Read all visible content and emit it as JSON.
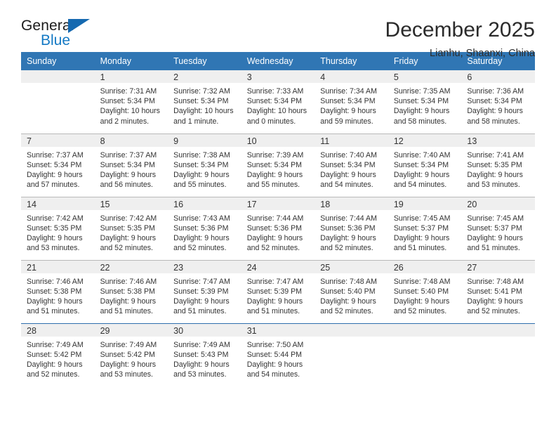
{
  "brand": {
    "name_part1": "General",
    "name_part2": "Blue",
    "accent_color": "#1479c4",
    "triangle_color": "#1569b0"
  },
  "header": {
    "title": "December 2025",
    "location": "Lianhu, Shaanxi, China",
    "header_bg": "#3076b4",
    "daynum_bg": "#efefef"
  },
  "weekdays": [
    "Sunday",
    "Monday",
    "Tuesday",
    "Wednesday",
    "Thursday",
    "Friday",
    "Saturday"
  ],
  "weeks": [
    [
      {
        "day": "",
        "sunrise": "",
        "sunset": "",
        "daylight_line1": "",
        "daylight_line2": "",
        "blank": true
      },
      {
        "day": "1",
        "sunrise": "Sunrise: 7:31 AM",
        "sunset": "Sunset: 5:34 PM",
        "daylight_line1": "Daylight: 10 hours",
        "daylight_line2": "and 2 minutes."
      },
      {
        "day": "2",
        "sunrise": "Sunrise: 7:32 AM",
        "sunset": "Sunset: 5:34 PM",
        "daylight_line1": "Daylight: 10 hours",
        "daylight_line2": "and 1 minute."
      },
      {
        "day": "3",
        "sunrise": "Sunrise: 7:33 AM",
        "sunset": "Sunset: 5:34 PM",
        "daylight_line1": "Daylight: 10 hours",
        "daylight_line2": "and 0 minutes."
      },
      {
        "day": "4",
        "sunrise": "Sunrise: 7:34 AM",
        "sunset": "Sunset: 5:34 PM",
        "daylight_line1": "Daylight: 9 hours",
        "daylight_line2": "and 59 minutes."
      },
      {
        "day": "5",
        "sunrise": "Sunrise: 7:35 AM",
        "sunset": "Sunset: 5:34 PM",
        "daylight_line1": "Daylight: 9 hours",
        "daylight_line2": "and 58 minutes."
      },
      {
        "day": "6",
        "sunrise": "Sunrise: 7:36 AM",
        "sunset": "Sunset: 5:34 PM",
        "daylight_line1": "Daylight: 9 hours",
        "daylight_line2": "and 58 minutes."
      }
    ],
    [
      {
        "day": "7",
        "sunrise": "Sunrise: 7:37 AM",
        "sunset": "Sunset: 5:34 PM",
        "daylight_line1": "Daylight: 9 hours",
        "daylight_line2": "and 57 minutes."
      },
      {
        "day": "8",
        "sunrise": "Sunrise: 7:37 AM",
        "sunset": "Sunset: 5:34 PM",
        "daylight_line1": "Daylight: 9 hours",
        "daylight_line2": "and 56 minutes."
      },
      {
        "day": "9",
        "sunrise": "Sunrise: 7:38 AM",
        "sunset": "Sunset: 5:34 PM",
        "daylight_line1": "Daylight: 9 hours",
        "daylight_line2": "and 55 minutes."
      },
      {
        "day": "10",
        "sunrise": "Sunrise: 7:39 AM",
        "sunset": "Sunset: 5:34 PM",
        "daylight_line1": "Daylight: 9 hours",
        "daylight_line2": "and 55 minutes."
      },
      {
        "day": "11",
        "sunrise": "Sunrise: 7:40 AM",
        "sunset": "Sunset: 5:34 PM",
        "daylight_line1": "Daylight: 9 hours",
        "daylight_line2": "and 54 minutes."
      },
      {
        "day": "12",
        "sunrise": "Sunrise: 7:40 AM",
        "sunset": "Sunset: 5:34 PM",
        "daylight_line1": "Daylight: 9 hours",
        "daylight_line2": "and 54 minutes."
      },
      {
        "day": "13",
        "sunrise": "Sunrise: 7:41 AM",
        "sunset": "Sunset: 5:35 PM",
        "daylight_line1": "Daylight: 9 hours",
        "daylight_line2": "and 53 minutes."
      }
    ],
    [
      {
        "day": "14",
        "sunrise": "Sunrise: 7:42 AM",
        "sunset": "Sunset: 5:35 PM",
        "daylight_line1": "Daylight: 9 hours",
        "daylight_line2": "and 53 minutes."
      },
      {
        "day": "15",
        "sunrise": "Sunrise: 7:42 AM",
        "sunset": "Sunset: 5:35 PM",
        "daylight_line1": "Daylight: 9 hours",
        "daylight_line2": "and 52 minutes."
      },
      {
        "day": "16",
        "sunrise": "Sunrise: 7:43 AM",
        "sunset": "Sunset: 5:36 PM",
        "daylight_line1": "Daylight: 9 hours",
        "daylight_line2": "and 52 minutes."
      },
      {
        "day": "17",
        "sunrise": "Sunrise: 7:44 AM",
        "sunset": "Sunset: 5:36 PM",
        "daylight_line1": "Daylight: 9 hours",
        "daylight_line2": "and 52 minutes."
      },
      {
        "day": "18",
        "sunrise": "Sunrise: 7:44 AM",
        "sunset": "Sunset: 5:36 PM",
        "daylight_line1": "Daylight: 9 hours",
        "daylight_line2": "and 52 minutes."
      },
      {
        "day": "19",
        "sunrise": "Sunrise: 7:45 AM",
        "sunset": "Sunset: 5:37 PM",
        "daylight_line1": "Daylight: 9 hours",
        "daylight_line2": "and 51 minutes."
      },
      {
        "day": "20",
        "sunrise": "Sunrise: 7:45 AM",
        "sunset": "Sunset: 5:37 PM",
        "daylight_line1": "Daylight: 9 hours",
        "daylight_line2": "and 51 minutes."
      }
    ],
    [
      {
        "day": "21",
        "sunrise": "Sunrise: 7:46 AM",
        "sunset": "Sunset: 5:38 PM",
        "daylight_line1": "Daylight: 9 hours",
        "daylight_line2": "and 51 minutes."
      },
      {
        "day": "22",
        "sunrise": "Sunrise: 7:46 AM",
        "sunset": "Sunset: 5:38 PM",
        "daylight_line1": "Daylight: 9 hours",
        "daylight_line2": "and 51 minutes."
      },
      {
        "day": "23",
        "sunrise": "Sunrise: 7:47 AM",
        "sunset": "Sunset: 5:39 PM",
        "daylight_line1": "Daylight: 9 hours",
        "daylight_line2": "and 51 minutes."
      },
      {
        "day": "24",
        "sunrise": "Sunrise: 7:47 AM",
        "sunset": "Sunset: 5:39 PM",
        "daylight_line1": "Daylight: 9 hours",
        "daylight_line2": "and 51 minutes."
      },
      {
        "day": "25",
        "sunrise": "Sunrise: 7:48 AM",
        "sunset": "Sunset: 5:40 PM",
        "daylight_line1": "Daylight: 9 hours",
        "daylight_line2": "and 52 minutes."
      },
      {
        "day": "26",
        "sunrise": "Sunrise: 7:48 AM",
        "sunset": "Sunset: 5:40 PM",
        "daylight_line1": "Daylight: 9 hours",
        "daylight_line2": "and 52 minutes."
      },
      {
        "day": "27",
        "sunrise": "Sunrise: 7:48 AM",
        "sunset": "Sunset: 5:41 PM",
        "daylight_line1": "Daylight: 9 hours",
        "daylight_line2": "and 52 minutes."
      }
    ],
    [
      {
        "day": "28",
        "sunrise": "Sunrise: 7:49 AM",
        "sunset": "Sunset: 5:42 PM",
        "daylight_line1": "Daylight: 9 hours",
        "daylight_line2": "and 52 minutes."
      },
      {
        "day": "29",
        "sunrise": "Sunrise: 7:49 AM",
        "sunset": "Sunset: 5:42 PM",
        "daylight_line1": "Daylight: 9 hours",
        "daylight_line2": "and 53 minutes."
      },
      {
        "day": "30",
        "sunrise": "Sunrise: 7:49 AM",
        "sunset": "Sunset: 5:43 PM",
        "daylight_line1": "Daylight: 9 hours",
        "daylight_line2": "and 53 minutes."
      },
      {
        "day": "31",
        "sunrise": "Sunrise: 7:50 AM",
        "sunset": "Sunset: 5:44 PM",
        "daylight_line1": "Daylight: 9 hours",
        "daylight_line2": "and 54 minutes."
      },
      {
        "day": "",
        "sunrise": "",
        "sunset": "",
        "daylight_line1": "",
        "daylight_line2": "",
        "blank": true
      },
      {
        "day": "",
        "sunrise": "",
        "sunset": "",
        "daylight_line1": "",
        "daylight_line2": "",
        "blank": true
      },
      {
        "day": "",
        "sunrise": "",
        "sunset": "",
        "daylight_line1": "",
        "daylight_line2": "",
        "blank": true
      }
    ]
  ]
}
